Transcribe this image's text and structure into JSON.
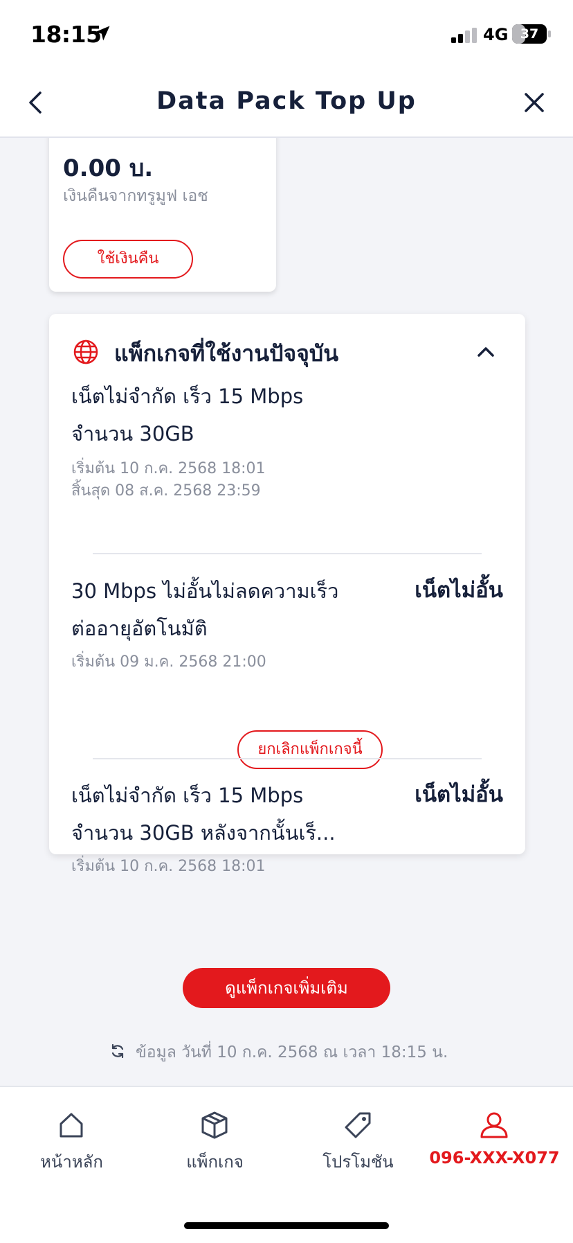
{
  "status_bar": {
    "time": "18:15",
    "network": "4G",
    "battery": "37",
    "battery_level": 0.37
  },
  "header": {
    "title": "Data Pack Top Up"
  },
  "credit_card": {
    "amount": "0.00 บ.",
    "subtitle": "เงินคืนจากทรูมูฟ เอช",
    "button_label": "ใช้เงินคืน"
  },
  "current_packages": {
    "title": "แพ็กเกจที่ใช้งานปัจจุบัน",
    "items": [
      {
        "name_line1": "เน็ตไม่จำกัด เร็ว 15 Mbps",
        "name_line2": "จำนวน 30GB",
        "badge": "",
        "start": "เริ่มต้น 10 ก.ค. 2568 18:01",
        "end": "สิ้นสุด 08 ส.ค. 2568 23:59"
      },
      {
        "name_line1": "30 Mbps ไม่อั้นไม่ลดความเร็ว",
        "name_line2": "ต่ออายุอัตโนมัติ",
        "badge": "เน็ตไม่อั้น",
        "start": "เริ่มต้น 09 ม.ค. 2568 21:00",
        "cancel_label": "ยกเลิกแพ็กเกจนี้"
      },
      {
        "name_line1": "เน็ตไม่จำกัด เร็ว 15 Mbps",
        "name_line2": "จำนวน 30GB หลังจากนั้นเร็...",
        "badge": "เน็ตไม่อั้น",
        "start": "เริ่มต้น 10 ก.ค. 2568 18:01"
      }
    ]
  },
  "more_button": {
    "label": "ดูแพ็กเกจเพิ่มเติม"
  },
  "last_updated": "ข้อมูล วันที่ 10 ก.ค. 2568 ณ เวลา 18:15 น.",
  "bottom_nav": {
    "home": "หน้าหลัก",
    "packages": "แพ็กเกจ",
    "promotions": "โปรโมชัน",
    "account": "096-XXX-X077"
  },
  "colors": {
    "accent": "#e3191d",
    "text": "#16203a",
    "muted": "#8a8f9c",
    "background": "#f3f4f8"
  }
}
